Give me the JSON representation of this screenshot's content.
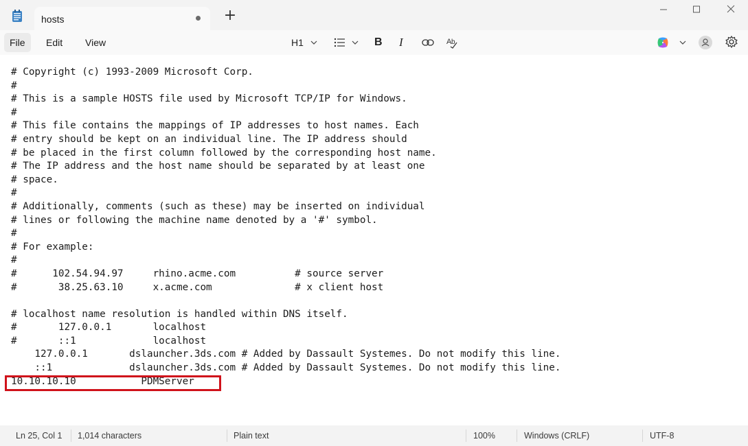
{
  "tab": {
    "title": "hosts",
    "unsaved_indicator": "dot"
  },
  "titlebar": {
    "new_tab_label": "+",
    "minimize": "minimize-icon",
    "maximize": "maximize-icon",
    "close": "close-icon"
  },
  "menu": {
    "file": "File",
    "edit": "Edit",
    "view": "View"
  },
  "toolbar": {
    "heading_label": "H1",
    "list_icon": "bulleted-list-icon",
    "bold_label": "B",
    "italic_label": "I",
    "link_icon": "link-icon",
    "spellcheck_icon": "spellcheck-icon",
    "copilot_icon": "copilot-icon",
    "account_icon": "account-icon",
    "settings_icon": "gear-icon"
  },
  "editor": {
    "lines": [
      "# Copyright (c) 1993-2009 Microsoft Corp.",
      "#",
      "# This is a sample HOSTS file used by Microsoft TCP/IP for Windows.",
      "#",
      "# This file contains the mappings of IP addresses to host names. Each",
      "# entry should be kept on an individual line. The IP address should",
      "# be placed in the first column followed by the corresponding host name.",
      "# The IP address and the host name should be separated by at least one",
      "# space.",
      "#",
      "# Additionally, comments (such as these) may be inserted on individual",
      "# lines or following the machine name denoted by a '#' symbol.",
      "#",
      "# For example:",
      "#",
      "#      102.54.94.97     rhino.acme.com          # source server",
      "#       38.25.63.10     x.acme.com              # x client host",
      "",
      "# localhost name resolution is handled within DNS itself.",
      "#       127.0.0.1       localhost",
      "#       ::1             localhost",
      "    127.0.0.1       dslauncher.3ds.com # Added by Dassault Systemes. Do not modify this line.",
      "    ::1             dslauncher.3ds.com # Added by Dassault Systemes. Do not modify this line.",
      "10.10.10.10           PDMServer"
    ],
    "highlight_color": "#d0121b"
  },
  "status": {
    "position": "Ln 25, Col 1",
    "characters": "1,014 characters",
    "format": "Plain text",
    "zoom": "100%",
    "line_ending": "Windows (CRLF)",
    "encoding": "UTF-8"
  }
}
